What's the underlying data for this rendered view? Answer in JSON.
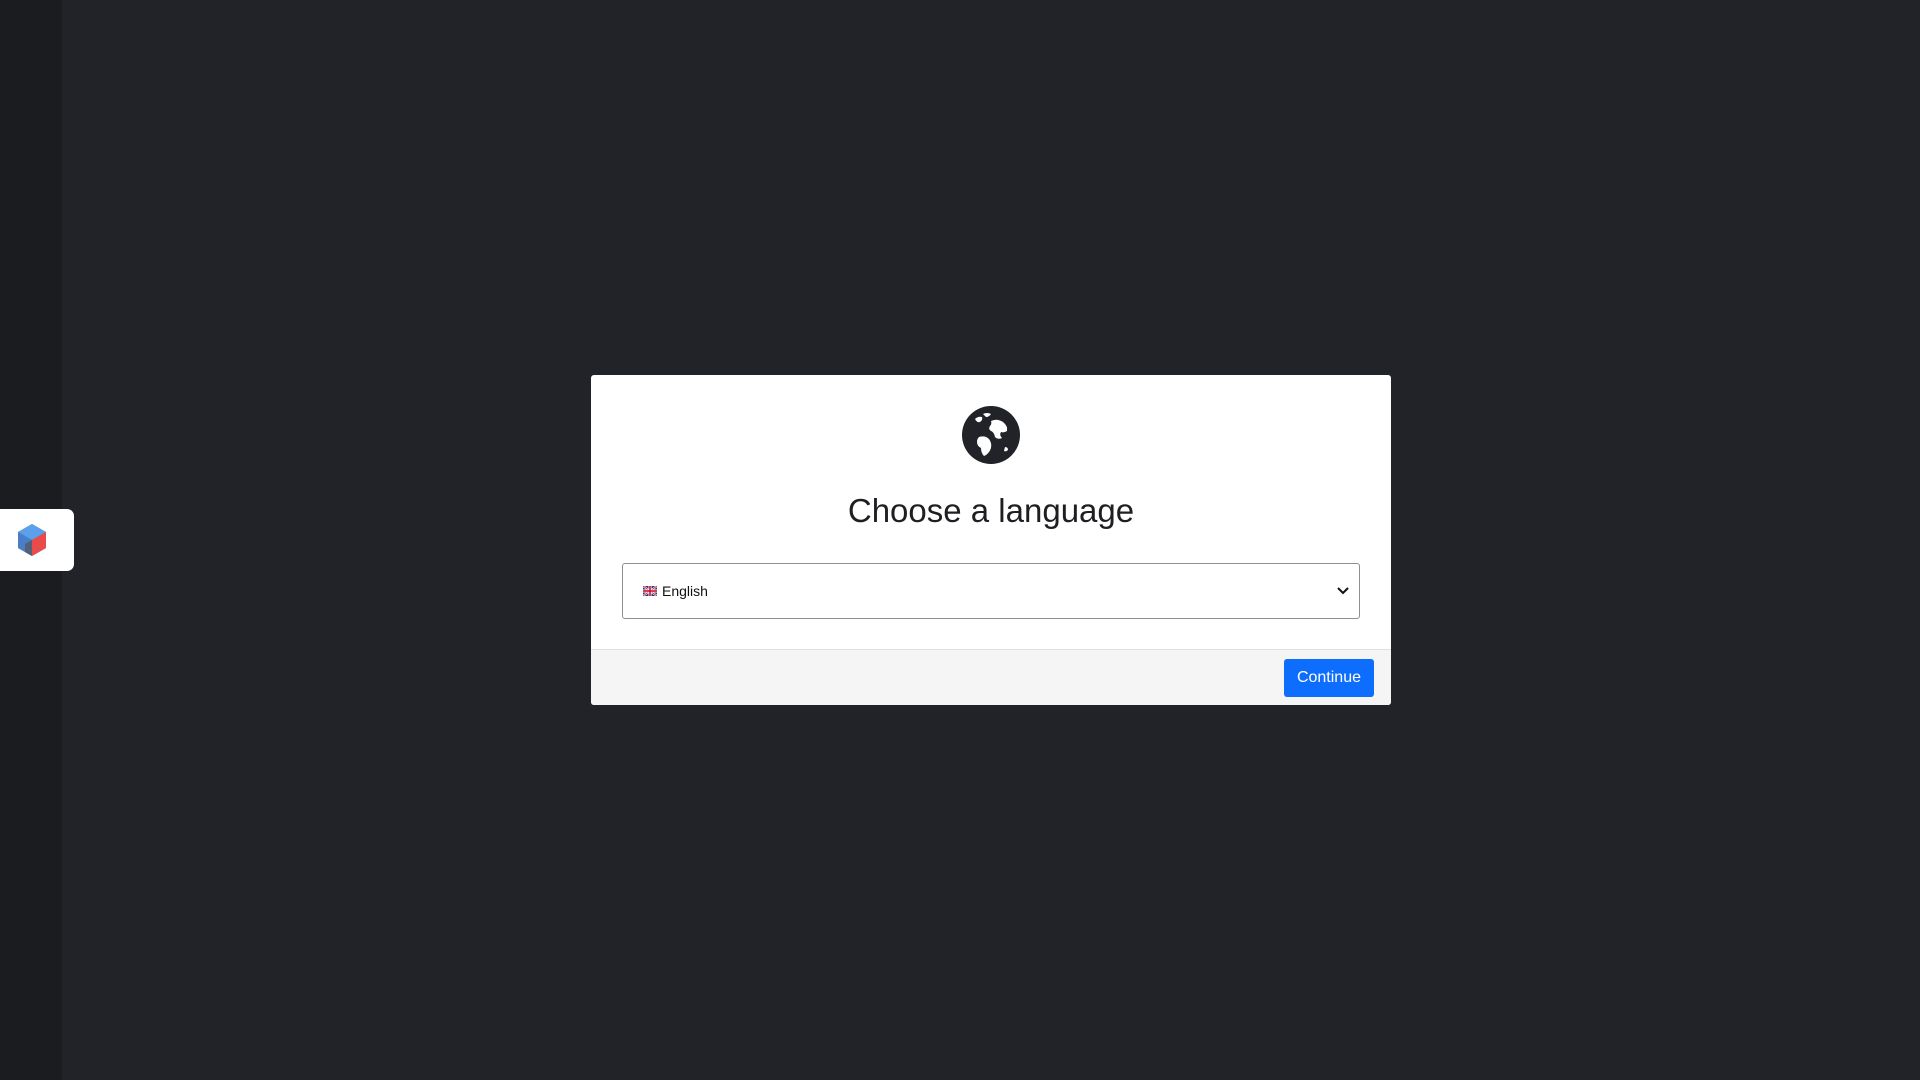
{
  "side_tab": {
    "icon": "cube-logo-icon",
    "colors": {
      "blue": "#4a90e2",
      "red": "#e94b4b",
      "gray": "#555a66"
    }
  },
  "modal": {
    "icon": "globe-icon",
    "title": "Choose a language",
    "language_select": {
      "flag": "uk-flag-icon",
      "selected": "English"
    },
    "continue_label": "Continue",
    "accent_color": "#0d6efd"
  }
}
